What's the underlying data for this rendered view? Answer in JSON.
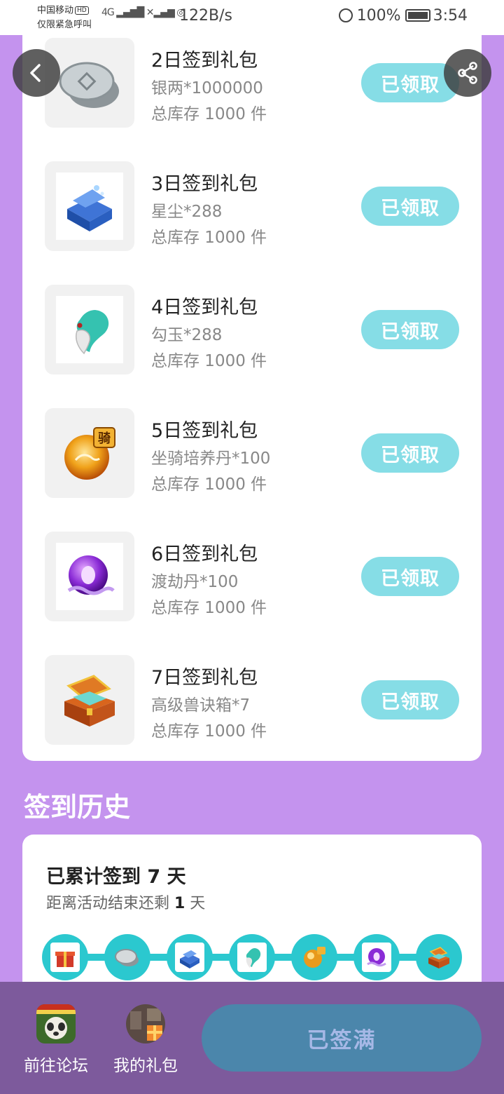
{
  "status_bar": {
    "carrier_line1": "中国移动",
    "carrier_hd": "HD",
    "carrier_line2": "仅限紧急呼叫",
    "signal": "4G",
    "net_speed": "122B/s",
    "battery": "100%",
    "time": "3:54"
  },
  "header": {
    "back_icon": "chevron-left-icon",
    "share_icon": "share-icon"
  },
  "gifts": [
    {
      "title": "2日签到礼包",
      "content": "银两*1000000",
      "stock": "总库存 1000 件",
      "button": "已领取",
      "icon": "silver-coin-icon"
    },
    {
      "title": "3日签到礼包",
      "content": "星尘*288",
      "stock": "总库存 1000 件",
      "button": "已领取",
      "icon": "stardust-box-icon"
    },
    {
      "title": "4日签到礼包",
      "content": "勾玉*288",
      "stock": "总库存 1000 件",
      "button": "已领取",
      "icon": "magatama-icon"
    },
    {
      "title": "5日签到礼包",
      "content": "坐骑培养丹*100",
      "stock": "总库存 1000 件",
      "button": "已领取",
      "icon": "mount-pill-icon",
      "badge": "骑"
    },
    {
      "title": "6日签到礼包",
      "content": "渡劫丹*100",
      "stock": "总库存 1000 件",
      "button": "已领取",
      "icon": "tribulation-pill-icon"
    },
    {
      "title": "7日签到礼包",
      "content": "高级兽诀箱*7",
      "stock": "总库存 1000 件",
      "button": "已领取",
      "icon": "treasure-chest-icon"
    }
  ],
  "history": {
    "section_title": "签到历史",
    "total_prefix": "已累计签到 ",
    "total_days": "7",
    "total_suffix": " 天",
    "remain_prefix": "距离活动结束还剩 ",
    "remain_days": "1",
    "remain_suffix": " 天",
    "timeline_icons": [
      "red-gift-icon",
      "silver-coin-icon",
      "stardust-box-icon",
      "magatama-icon",
      "mount-pill-icon",
      "tribulation-pill-icon",
      "treasure-chest-icon"
    ]
  },
  "bottom": {
    "forum_label": "前往论坛",
    "gifts_label": "我的礼包",
    "signed_button": "已签满"
  },
  "colors": {
    "background": "#c493ee",
    "claim_button": "#86dde6",
    "timeline": "#2bc8cf",
    "bottom_bar": "#7d5a9c",
    "signed_button": "#4b86ab"
  }
}
